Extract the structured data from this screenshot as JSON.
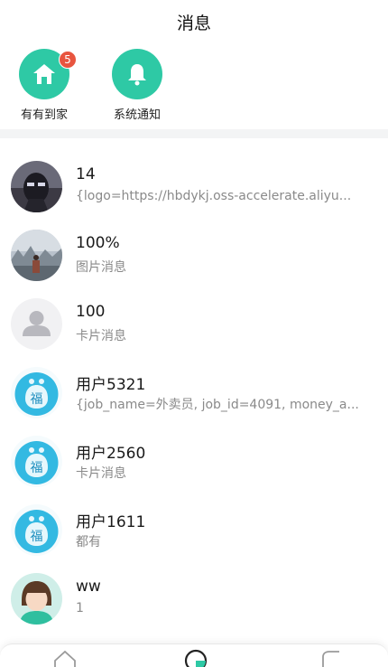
{
  "header": {
    "title": "消息"
  },
  "shortcuts": [
    {
      "label": "有有到家",
      "icon": "home-icon",
      "badge": "5"
    },
    {
      "label": "系统通知",
      "icon": "bell-icon",
      "badge": ""
    }
  ],
  "messages": [
    {
      "title": "14",
      "subtitle": "{logo=https://hbdykj.oss-accelerate.aliyu...",
      "avatar": "dark-character-avatar"
    },
    {
      "title": "100%",
      "subtitle": "图片消息",
      "avatar": "landscape-photo-avatar"
    },
    {
      "title": "100",
      "subtitle": "卡片消息",
      "avatar": "default-person-avatar"
    },
    {
      "title": "用户5321",
      "subtitle": "{job_name=外卖员, job_id=4091, money_a...",
      "avatar": "fu-bag-avatar",
      "avatar_text": "福"
    },
    {
      "title": "用户2560",
      "subtitle": "卡片消息",
      "avatar": "fu-bag-avatar",
      "avatar_text": "福"
    },
    {
      "title": "用户1611",
      "subtitle": "都有",
      "avatar": "fu-bag-avatar",
      "avatar_text": "福"
    },
    {
      "title": "ww",
      "subtitle": "1",
      "avatar": "cartoon-girl-avatar"
    }
  ],
  "tabbar": {
    "items": [
      "home-tab-icon",
      "message-tab-icon",
      "profile-tab-icon"
    ]
  },
  "colors": {
    "accent": "#2ec9a5",
    "badge": "#e8553f",
    "subtext": "#8a8a8a"
  }
}
